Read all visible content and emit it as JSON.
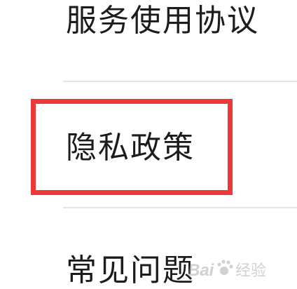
{
  "menu": {
    "items": [
      {
        "label": "服务使用协议"
      },
      {
        "label": "隐私政策"
      },
      {
        "label": "常见问题"
      }
    ]
  },
  "annotation": {
    "highlight_color": "#ec3838",
    "highlighted_item": "隐私政策"
  },
  "watermark": {
    "text": "Bai 经验",
    "icon": "paw-icon"
  }
}
